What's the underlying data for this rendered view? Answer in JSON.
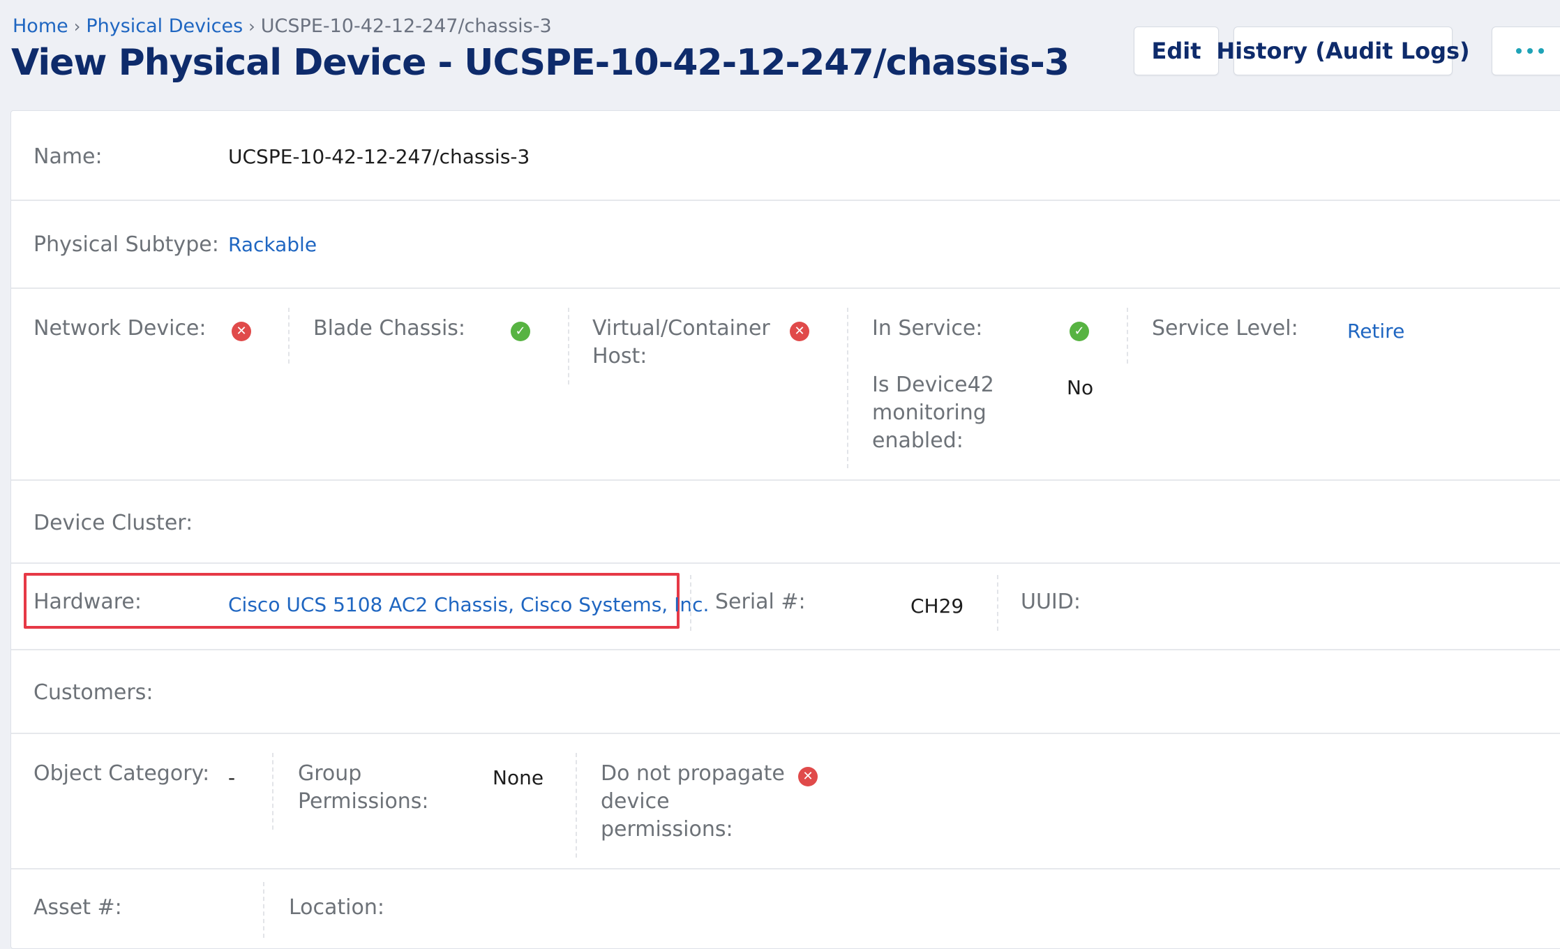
{
  "breadcrumb": {
    "home": "Home",
    "physical_devices": "Physical Devices",
    "current": "UCSPE-10-42-12-247/chassis-3",
    "separator": "›"
  },
  "page_title": "View Physical Device - UCSPE-10-42-12-247/chassis-3",
  "actions": {
    "edit": "Edit",
    "history": "History (Audit Logs)"
  },
  "fields": {
    "name": {
      "label": "Name:",
      "value": "UCSPE-10-42-12-247/chassis-3"
    },
    "physical_subtype": {
      "label": "Physical Subtype:",
      "value": "Rackable"
    },
    "network_device": {
      "label": "Network Device:",
      "status": "no"
    },
    "blade_chassis": {
      "label": "Blade Chassis:",
      "status": "yes"
    },
    "virtual_host": {
      "label_line1": "Virtual/Container",
      "label_line2": "Host:",
      "status": "no"
    },
    "in_service": {
      "label": "In Service:",
      "status": "yes"
    },
    "monitoring": {
      "label_line1": "Is Device42",
      "label_line2": "monitoring",
      "label_line3": "enabled:",
      "value": "No"
    },
    "service_level": {
      "label": "Service Level:",
      "value": "Retire"
    },
    "device_cluster": {
      "label": "Device Cluster:"
    },
    "hardware": {
      "label": "Hardware:",
      "value": "Cisco UCS 5108 AC2 Chassis, Cisco Systems, Inc."
    },
    "serial": {
      "label": "Serial #:",
      "value": "CH29"
    },
    "uuid": {
      "label": "UUID:"
    },
    "customers": {
      "label": "Customers:"
    },
    "object_category": {
      "label": "Object Category:",
      "value": "-"
    },
    "group_permissions": {
      "label_line1": "Group",
      "label_line2": "Permissions:",
      "value": "None"
    },
    "no_propagate": {
      "label_line1": "Do not propagate",
      "label_line2": "device",
      "label_line3": "permissions:",
      "status": "no"
    },
    "asset_number": {
      "label": "Asset #:"
    },
    "location": {
      "label": "Location:"
    }
  },
  "colors": {
    "title": "#0e2b6b",
    "link": "#1f66c1",
    "no_icon": "#e04a4a",
    "yes_icon": "#57b342",
    "highlight": "#e63946"
  }
}
